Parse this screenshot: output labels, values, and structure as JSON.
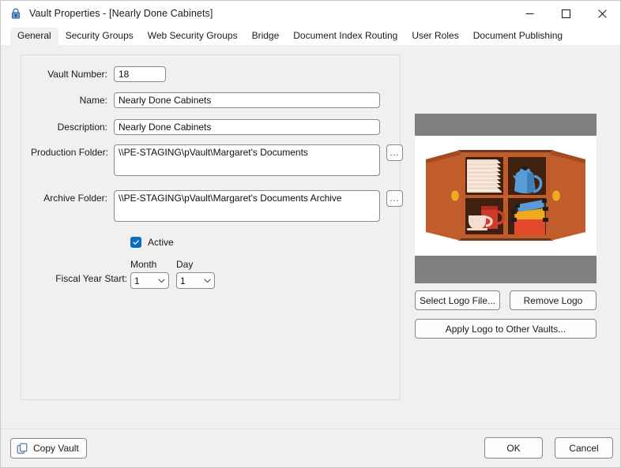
{
  "window": {
    "title": "Vault Properties - [Nearly Done Cabinets]",
    "icon": "lock-icon",
    "minimize_label": "–",
    "maximize_label": "□",
    "close_label": "✕"
  },
  "tabs": [
    {
      "label": "General",
      "selected": true
    },
    {
      "label": "Security Groups",
      "selected": false
    },
    {
      "label": "Web Security Groups",
      "selected": false
    },
    {
      "label": "Bridge",
      "selected": false
    },
    {
      "label": "Document Index Routing",
      "selected": false
    },
    {
      "label": "User Roles",
      "selected": false
    },
    {
      "label": "Document Publishing",
      "selected": false
    }
  ],
  "general": {
    "vault_number": {
      "label": "Vault Number:",
      "value": "18"
    },
    "name": {
      "label": "Name:",
      "value": "Nearly Done Cabinets"
    },
    "description": {
      "label": "Description:",
      "value": "Nearly Done Cabinets"
    },
    "production_folder": {
      "label": "Production Folder:",
      "value": "\\\\PE-STAGING\\pVault\\Margaret's Documents",
      "browse_label": "..."
    },
    "archive_folder": {
      "label": "Archive Folder:",
      "value": "\\\\PE-STAGING\\pVault\\Margaret's Documents Archive",
      "browse_label": "..."
    },
    "active": {
      "label": "Active",
      "checked": true
    },
    "fiscal_year_start": {
      "label": "Fiscal Year Start:",
      "month_header": "Month",
      "month_value": "1",
      "day_header": "Day",
      "day_value": "1"
    }
  },
  "logo": {
    "image_name": "cabinet-logo-image",
    "background_color": "#808080",
    "select_logo_label": "Select Logo File...",
    "remove_logo_label": "Remove Logo",
    "apply_logo_label": "Apply Logo to Other Vaults..."
  },
  "footer": {
    "copy_vault_label": "Copy Vault",
    "ok_label": "OK",
    "cancel_label": "Cancel"
  }
}
